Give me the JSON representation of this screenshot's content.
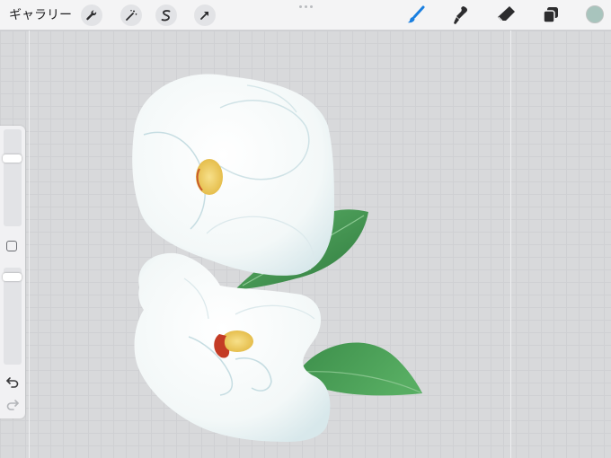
{
  "toolbar": {
    "gallery_label": "ギャラリー",
    "left_tools": [
      "wrench-icon",
      "magic-wand-icon",
      "selection-icon",
      "transform-arrow-icon"
    ],
    "right_tools": [
      "brush-icon",
      "smudge-icon",
      "eraser-icon",
      "layers-icon"
    ],
    "active_tool": "brush-icon",
    "accent_color": "#1a7fe0",
    "current_color": "#a8c4bd"
  },
  "sidebar": {
    "brush_size_level": 0.28,
    "opacity_level": 0.06
  },
  "colors": {
    "canvas_bg": "#d8d9db",
    "petal": "#ffffff",
    "petal_shadow": "#d6e7ea",
    "leaf_light": "#4aa35a",
    "leaf_dark": "#2f7d3f",
    "stamen": "#f3d36a",
    "stamen_base": "#c43b25"
  }
}
